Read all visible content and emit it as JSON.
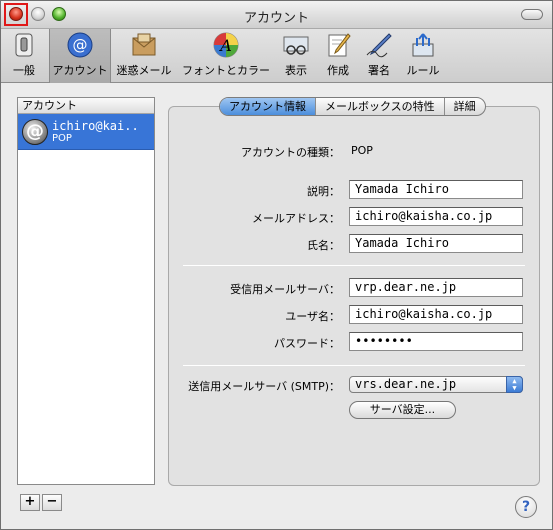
{
  "window": {
    "title": "アカウント"
  },
  "toolbar": {
    "items": [
      {
        "label": "一般",
        "icon": "general-switch-icon"
      },
      {
        "label": "アカウント",
        "icon": "at-sign-icon"
      },
      {
        "label": "迷惑メール",
        "icon": "junk-mail-icon"
      },
      {
        "label": "フォントとカラー",
        "icon": "font-color-icon"
      },
      {
        "label": "表示",
        "icon": "view-glasses-icon"
      },
      {
        "label": "作成",
        "icon": "compose-icon"
      },
      {
        "label": "署名",
        "icon": "signature-pen-icon"
      },
      {
        "label": "ルール",
        "icon": "rules-icon"
      }
    ],
    "selected": "アカウント"
  },
  "sidebar": {
    "header": "アカウント",
    "accounts": [
      {
        "name": "ichiro@kai..",
        "type": "POP"
      }
    ],
    "add_label": "+",
    "remove_label": "−"
  },
  "tabs": [
    {
      "label": "アカウント情報",
      "active": true
    },
    {
      "label": "メールボックスの特性",
      "active": false
    },
    {
      "label": "詳細",
      "active": false
    }
  ],
  "form": {
    "account_type_label": "アカウントの種類：",
    "account_type_value": "POP",
    "description_label": "説明：",
    "description_value": "Yamada Ichiro",
    "email_label": "メールアドレス：",
    "email_value": "ichiro@kaisha.co.jp",
    "fullname_label": "氏名：",
    "fullname_value": "Yamada Ichiro",
    "incoming_label": "受信用メールサーバ：",
    "incoming_value": "vrp.dear.ne.jp",
    "username_label": "ユーザ名：",
    "username_value": "ichiro@kaisha.co.jp",
    "password_label": "パスワード：",
    "password_value": "••••••••",
    "smtp_label": "送信用メールサーバ (SMTP)：",
    "smtp_value": "vrs.dear.ne.jp",
    "server_settings_label": "サーバ設定..."
  },
  "help": {
    "label": "?"
  },
  "colors": {
    "selection": "#3875d7",
    "accent": "#4c8edc",
    "focus_ring": "#e01818"
  }
}
